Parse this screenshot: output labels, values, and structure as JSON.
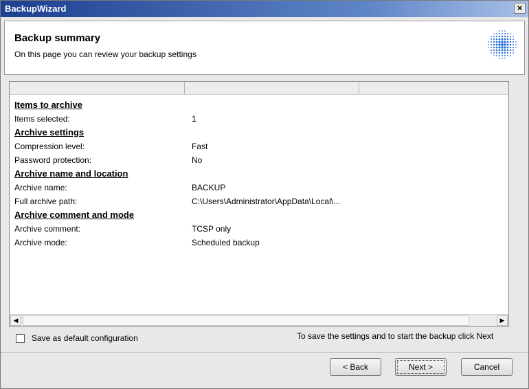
{
  "window": {
    "title": "BackupWizard",
    "close_label": "×"
  },
  "header": {
    "title": "Backup summary",
    "subtitle": "On this page you can review your backup settings"
  },
  "summary": {
    "rows": [
      {
        "kind": "section",
        "label": "Items to archive"
      },
      {
        "kind": "item",
        "label": "Items selected:",
        "value": "1"
      },
      {
        "kind": "section",
        "label": "Archive settings"
      },
      {
        "kind": "item",
        "label": "Compression level:",
        "value": "Fast"
      },
      {
        "kind": "item",
        "label": "Password protection:",
        "value": "No"
      },
      {
        "kind": "section",
        "label": "Archive name and location"
      },
      {
        "kind": "item",
        "label": "Archive name:",
        "value": "BACKUP"
      },
      {
        "kind": "item",
        "label": "Full archive path:",
        "value": "C:\\Users\\Administrator\\AppData\\Local\\..."
      },
      {
        "kind": "section",
        "label": "Archive comment and mode"
      },
      {
        "kind": "item",
        "label": "Archive comment:",
        "value": "TCSP only"
      },
      {
        "kind": "item",
        "label": "Archive mode:",
        "value": "Scheduled backup"
      }
    ]
  },
  "scrollbar": {
    "left_arrow": "◀",
    "right_arrow": "▶"
  },
  "options": {
    "save_default_label": "Save as default configuration",
    "save_default_checked": false
  },
  "hint": "To save the settings and to start the backup click Next",
  "buttons": {
    "back": "< Back",
    "next": "Next >",
    "cancel": "Cancel"
  },
  "icons": {
    "logo": "dotted-globe-icon"
  },
  "colors": {
    "titlebar_start": "#1c3f8f",
    "titlebar_end": "#a9c0e6",
    "logo": "#2a6fd8"
  }
}
